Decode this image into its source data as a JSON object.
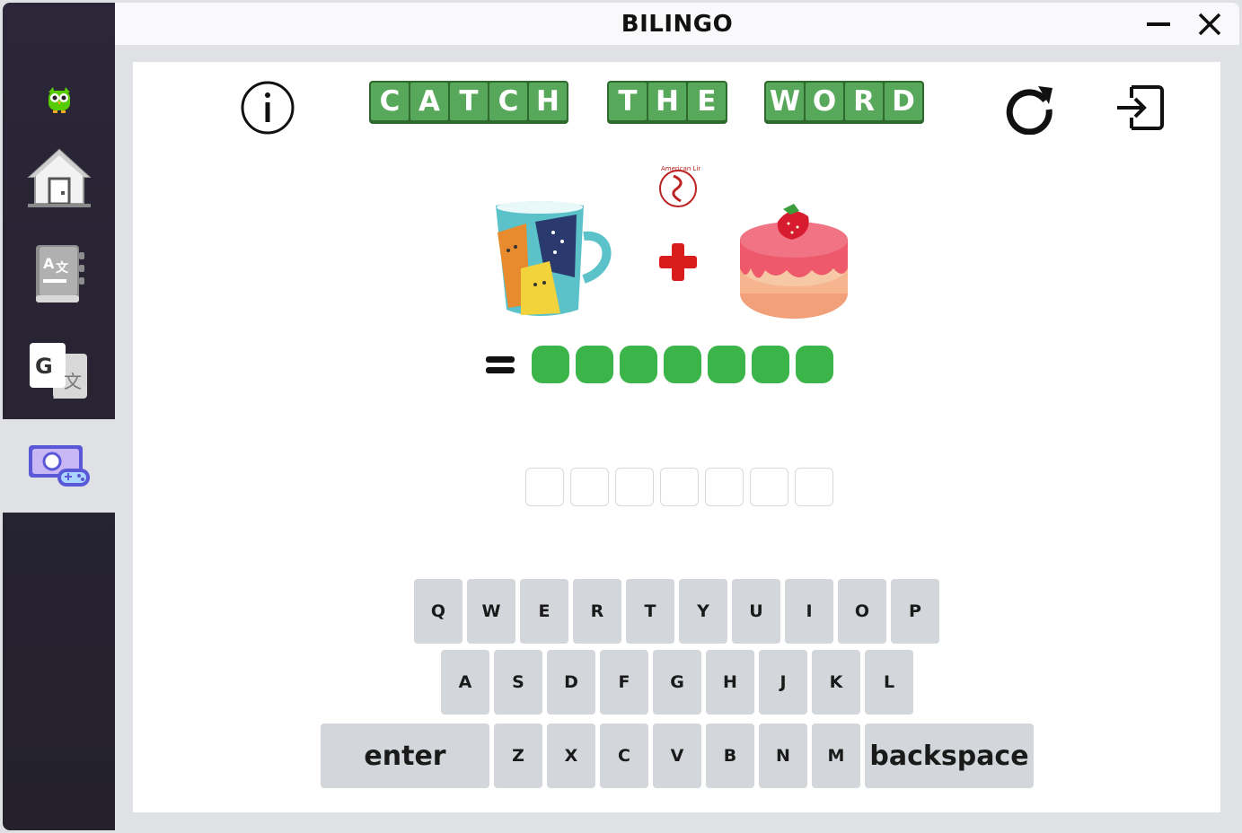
{
  "window": {
    "title": "BILINGO",
    "minimize_icon": "minimize-icon",
    "close_icon": "close-icon"
  },
  "sidebar": {
    "items": [
      {
        "name": "logo",
        "icon": "owl-logo-icon",
        "active": false
      },
      {
        "name": "home",
        "icon": "home-icon",
        "active": false
      },
      {
        "name": "dictionary",
        "icon": "dictionary-book-icon",
        "active": false
      },
      {
        "name": "translate",
        "icon": "google-translate-icon",
        "active": false
      },
      {
        "name": "games",
        "icon": "game-controller-icon",
        "active": true
      }
    ]
  },
  "toolbar": {
    "info_icon": "info-icon",
    "refresh_icon": "refresh-icon",
    "exit_icon": "exit-icon"
  },
  "game": {
    "title_words": [
      [
        "C",
        "A",
        "T",
        "C",
        "H"
      ],
      [
        "T",
        "H",
        "E"
      ],
      [
        "W",
        "O",
        "R",
        "D"
      ]
    ],
    "clue_images": [
      "mug-with-cats-image",
      "plus-icon",
      "cake-image"
    ],
    "watermark": "American Links",
    "hidden_letter_count": 7,
    "answer_boxes": [
      "",
      "",
      "",
      "",
      "",
      "",
      ""
    ]
  },
  "keyboard": {
    "row1": [
      "Q",
      "W",
      "E",
      "R",
      "T",
      "Y",
      "U",
      "I",
      "O",
      "P"
    ],
    "row2": [
      "A",
      "S",
      "D",
      "F",
      "G",
      "H",
      "J",
      "K",
      "L"
    ],
    "row3": [
      "Z",
      "X",
      "C",
      "V",
      "B",
      "N",
      "M"
    ],
    "enter_label": "enter",
    "backspace_label": "backspace"
  },
  "colors": {
    "sidebar_bg": "#2b2638",
    "tile_green": "#57a85a",
    "dot_green": "#3bb54a",
    "key_gray": "#d3d6da"
  }
}
